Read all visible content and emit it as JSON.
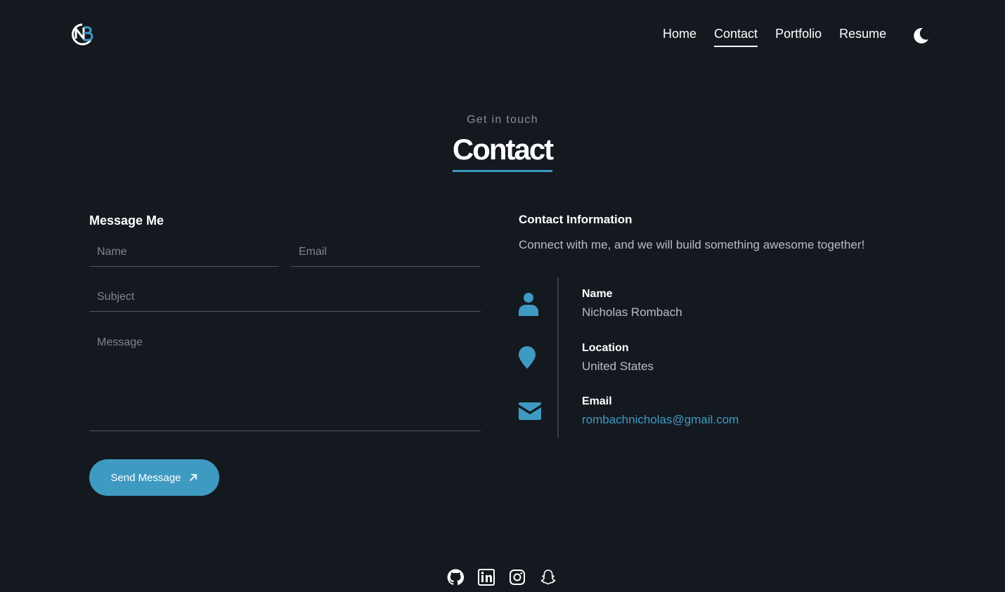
{
  "nav": {
    "items": [
      {
        "label": "Home",
        "active": false
      },
      {
        "label": "Contact",
        "active": true
      },
      {
        "label": "Portfolio",
        "active": false
      },
      {
        "label": "Resume",
        "active": false
      }
    ],
    "theme_icon": "moon-icon"
  },
  "hero": {
    "eyebrow": "Get in touch",
    "title": "Contact"
  },
  "form": {
    "title": "Message Me",
    "name_placeholder": "Name",
    "email_placeholder": "Email",
    "subject_placeholder": "Subject",
    "message_placeholder": "Message",
    "send_label": "Send Message"
  },
  "info": {
    "title": "Contact Information",
    "description": "Connect with me, and we will build something awesome together!",
    "items": [
      {
        "icon": "person-icon",
        "label": "Name",
        "value": "Nicholas Rombach"
      },
      {
        "icon": "location-pin-icon",
        "label": "Location",
        "value": "United States"
      },
      {
        "icon": "envelope-icon",
        "label": "Email",
        "value": "rombachnicholas@gmail.com"
      }
    ]
  },
  "socials": [
    "github-icon",
    "linkedin-icon",
    "instagram-icon",
    "snapchat-icon"
  ],
  "colors": {
    "background": "#141920",
    "accent": "#3f9ac2",
    "text": "#ffffff",
    "muted": "#b9bdc2"
  }
}
